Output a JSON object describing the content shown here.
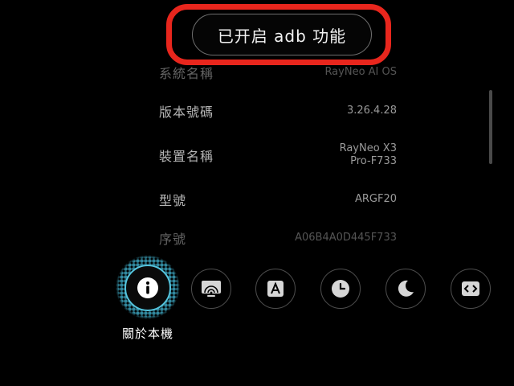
{
  "page_title": "關於本機",
  "toast": {
    "text": "已开启 adb 功能"
  },
  "info_rows": [
    {
      "label": "系統名稱",
      "value": "RayNeo AI OS"
    },
    {
      "label": "版本號碼",
      "value": "3.26.4.28"
    },
    {
      "label": "裝置名稱",
      "value_line1": "RayNeo X3",
      "value_line2": "Pro-F733"
    },
    {
      "label": "型號",
      "value": "ARGF20"
    },
    {
      "label": "序號",
      "value": "A06B4A0D445F733"
    }
  ],
  "dock": {
    "items": [
      {
        "icon": "info-icon",
        "label": "關於本機",
        "active": true
      },
      {
        "icon": "screen-cast-icon",
        "active": false
      },
      {
        "icon": "font-size-icon",
        "active": false
      },
      {
        "icon": "clock-icon",
        "active": false
      },
      {
        "icon": "dark-mode-icon",
        "active": false
      },
      {
        "icon": "developer-options-icon",
        "active": false
      }
    ]
  },
  "colors": {
    "background": "#000000",
    "accent": "#55c4dd",
    "highlight": "#e8261d"
  }
}
